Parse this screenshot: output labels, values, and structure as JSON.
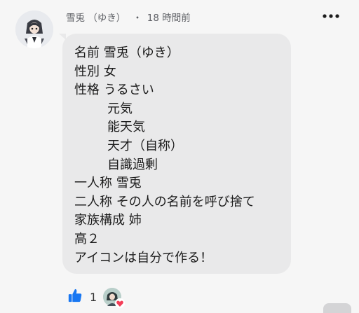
{
  "post": {
    "author_name": "雪兎 （ゆき）",
    "separator": "・",
    "timestamp": "18 時間前"
  },
  "comment": {
    "lines": [
      {
        "text": "名前 雪兎（ゆき）",
        "indent": false
      },
      {
        "text": "性別 女",
        "indent": false
      },
      {
        "text": "性格 うるさい",
        "indent": false
      },
      {
        "text": "元気",
        "indent": true
      },
      {
        "text": "能天気",
        "indent": true
      },
      {
        "text": "天才（自称）",
        "indent": true
      },
      {
        "text": "自識過剰",
        "indent": true
      },
      {
        "text": "一人称 雪兎",
        "indent": false
      },
      {
        "text": "二人称 その人の名前を呼び捨て",
        "indent": false
      },
      {
        "text": "家族構成 姉",
        "indent": false
      },
      {
        "text": "高２",
        "indent": false
      },
      {
        "text": "アイコンは自分で作る！",
        "indent": false
      }
    ]
  },
  "reactions": {
    "like_count": "1",
    "like_icon": "thumbs-up-icon",
    "badge_icon": "heart-icon"
  },
  "colors": {
    "background": "#f6f6f6",
    "bubble": "#e9e9ea",
    "like_blue": "#1877f2",
    "heart_red": "#f33e58",
    "meta_text": "#5f6166"
  }
}
